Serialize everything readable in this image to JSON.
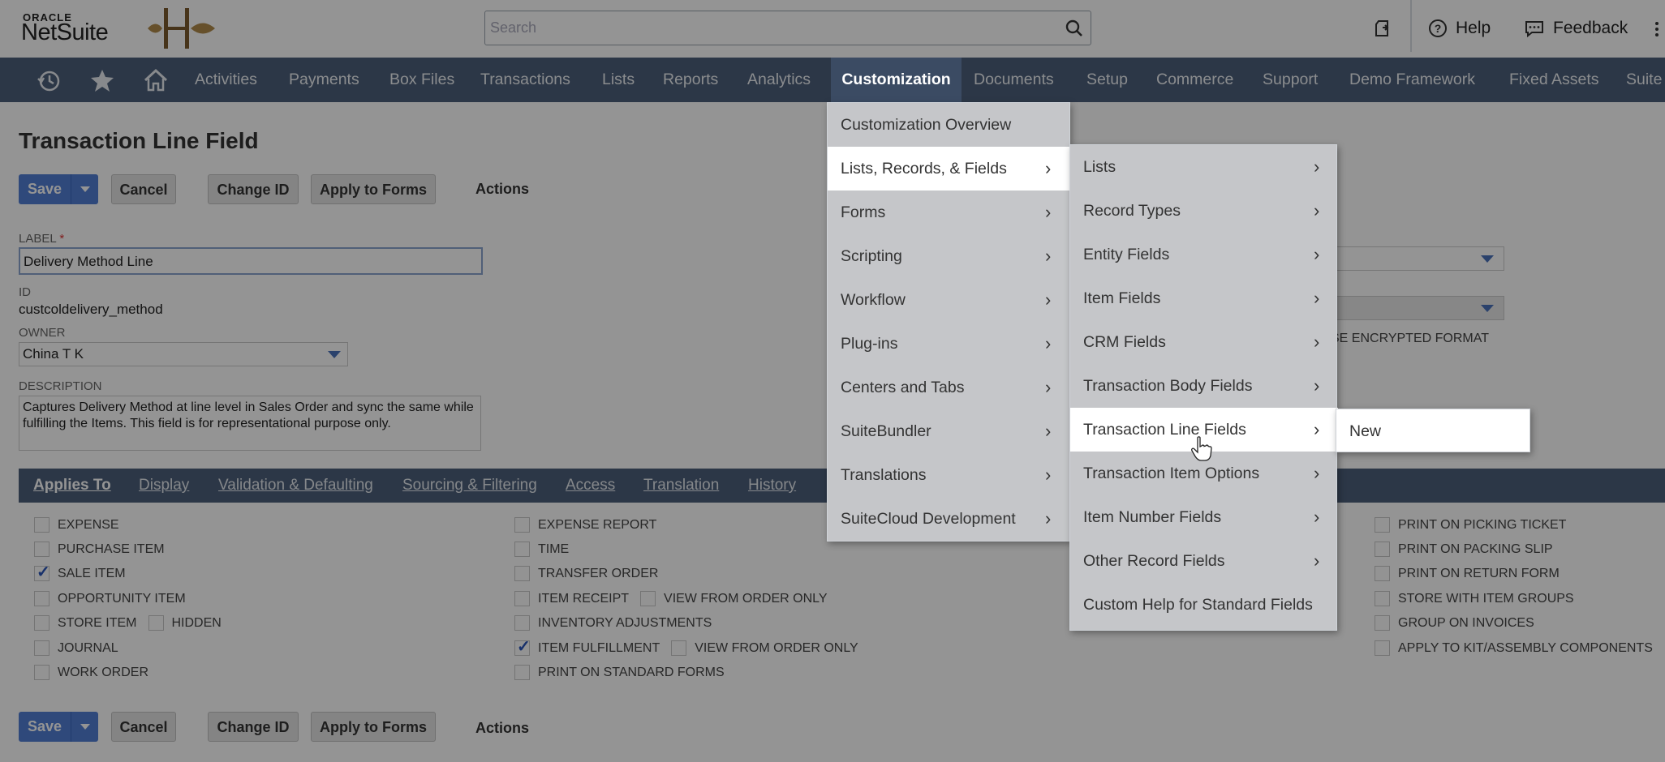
{
  "brand": {
    "oracle": "ORACLE",
    "netsuite": "NetSuite"
  },
  "search": {
    "placeholder": "Search"
  },
  "header": {
    "help": "Help",
    "feedback": "Feedback"
  },
  "nav": {
    "items": [
      "Activities",
      "Payments",
      "Box Files",
      "Transactions",
      "Lists",
      "Reports",
      "Analytics",
      "Customization",
      "Documents",
      "Setup",
      "Commerce",
      "Support",
      "Demo Framework",
      "Fixed Assets",
      "Suite"
    ]
  },
  "page": {
    "title": "Transaction Line Field",
    "buttons": {
      "save": "Save",
      "cancel": "Cancel",
      "change_id": "Change ID",
      "apply_to_forms": "Apply to Forms",
      "actions": "Actions"
    },
    "fields": {
      "label_label": "LABEL",
      "label_value": "Delivery Method Line",
      "id_label": "ID",
      "id_value": "custcoldelivery_method",
      "owner_label": "OWNER",
      "owner_value": "China T K",
      "description_label": "DESCRIPTION",
      "description_value": "Captures Delivery Method at line level in Sales Order and sync the same while fulfilling the Items. This field is for representational purpose only.",
      "encrypted_fragment": "SE ENCRYPTED FORMAT"
    },
    "subtabs": [
      "Applies To",
      "Display",
      "Validation & Defaulting",
      "Sourcing & Filtering",
      "Access",
      "Translation",
      "History"
    ],
    "applies_to": {
      "col1": [
        {
          "label": "EXPENSE",
          "checked": false
        },
        {
          "label": "PURCHASE ITEM",
          "checked": false
        },
        {
          "label": "SALE ITEM",
          "checked": true
        },
        {
          "label": "OPPORTUNITY ITEM",
          "checked": false
        },
        {
          "label": "STORE ITEM",
          "checked": false
        },
        {
          "label": "JOURNAL",
          "checked": false
        },
        {
          "label": "WORK ORDER",
          "checked": false
        }
      ],
      "store_hidden": "HIDDEN",
      "col2": [
        {
          "label": "EXPENSE REPORT",
          "checked": false
        },
        {
          "label": "TIME",
          "checked": false
        },
        {
          "label": "TRANSFER ORDER",
          "checked": false
        },
        {
          "label": "ITEM RECEIPT",
          "checked": false
        },
        {
          "label": "INVENTORY ADJUSTMENTS",
          "checked": false
        },
        {
          "label": "ITEM FULFILLMENT",
          "checked": true
        },
        {
          "label": "PRINT ON STANDARD FORMS",
          "checked": false
        }
      ],
      "view_from_order_only": "VIEW FROM ORDER ONLY",
      "col3": [
        {
          "label": "PRINT ON PICKING TICKET",
          "checked": false
        },
        {
          "label": "PRINT ON PACKING SLIP",
          "checked": false
        },
        {
          "label": "PRINT ON RETURN FORM",
          "checked": false
        },
        {
          "label": "STORE WITH ITEM GROUPS",
          "checked": false
        },
        {
          "label": "GROUP ON INVOICES",
          "checked": false
        },
        {
          "label": "APPLY TO KIT/ASSEMBLY COMPONENTS",
          "checked": false
        }
      ]
    }
  },
  "customization_menu": {
    "items": [
      "Customization Overview",
      "Lists, Records, & Fields",
      "Forms",
      "Scripting",
      "Workflow",
      "Plug-ins",
      "Centers and Tabs",
      "SuiteBundler",
      "Translations",
      "SuiteCloud Development"
    ]
  },
  "lists_submenu": {
    "items": [
      "Lists",
      "Record Types",
      "Entity Fields",
      "Item Fields",
      "CRM Fields",
      "Transaction Body Fields",
      "Transaction Line Fields",
      "Transaction Item Options",
      "Item Number Fields",
      "Other Record Fields",
      "Custom Help for Standard Fields"
    ]
  },
  "line_fields_submenu": {
    "new": "New"
  }
}
